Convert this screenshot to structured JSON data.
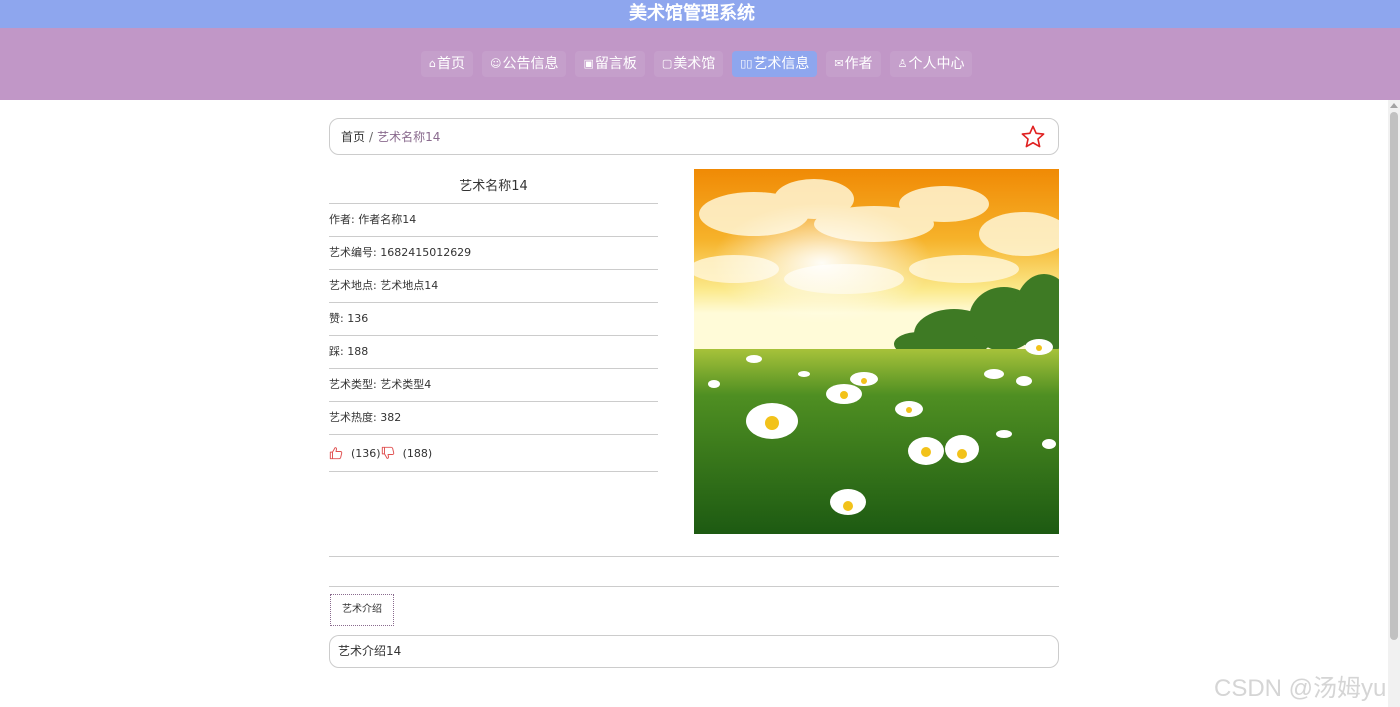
{
  "header": {
    "title": "美术馆管理系统"
  },
  "nav": [
    {
      "icon": "home-icon",
      "glyph": "⌂",
      "label": "首页",
      "active": false
    },
    {
      "icon": "announcement-icon",
      "glyph": "☺",
      "label": "公告信息",
      "active": false
    },
    {
      "icon": "message-board-icon",
      "glyph": "▣",
      "label": "留言板",
      "active": false
    },
    {
      "icon": "museum-icon",
      "glyph": "▢",
      "label": "美术馆",
      "active": false
    },
    {
      "icon": "art-info-icon",
      "glyph": "▯▯",
      "label": "艺术信息",
      "active": true
    },
    {
      "icon": "author-icon",
      "glyph": "✉",
      "label": "作者",
      "active": false
    },
    {
      "icon": "user-icon",
      "glyph": "♙",
      "label": "个人中心",
      "active": false
    }
  ],
  "breadcrumb": {
    "home": "首页",
    "separator": "/",
    "current": "艺术名称14"
  },
  "detail": {
    "name": "艺术名称14",
    "author": "作者: 作者名称14",
    "number": "艺术编号: 1682415012629",
    "location": "艺术地点: 艺术地点14",
    "likes": "赞: 136",
    "dislikes": "踩: 188",
    "type": "艺术类型: 艺术类型4",
    "heat": "艺术热度: 382",
    "like_count": "(136)",
    "dislike_count": "(188)"
  },
  "tabs": {
    "intro_tab": "艺术介绍"
  },
  "intro_text": "艺术介绍14",
  "watermark": "CSDN @汤姆yu",
  "colors": {
    "topbar": "#8ea6ee",
    "navbar": "#c197c7",
    "star": "#e02020",
    "vote": "#e05050"
  }
}
